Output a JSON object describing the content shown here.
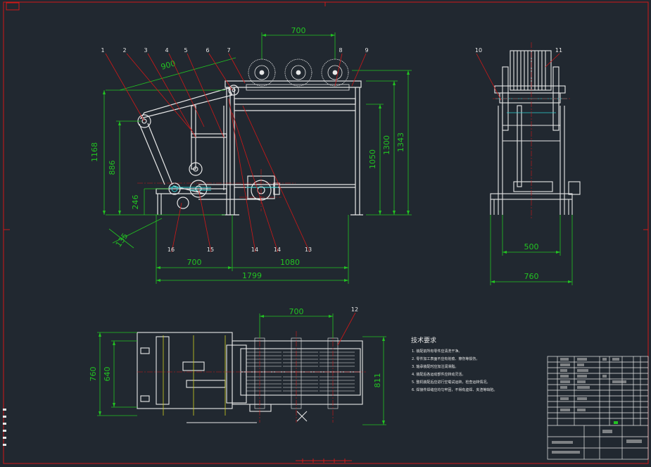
{
  "colors": {
    "background": "#212830",
    "frame": "#d01818",
    "outline": "#e8e8e8",
    "dimension": "#22c322",
    "leader": "#d01818",
    "centerline": "#d01818",
    "detail_cyan": "#30d0d0",
    "detail_yellow": "#d0d020"
  },
  "front_view": {
    "dims": {
      "brush_pitch": "700",
      "arm_length": "900",
      "height_1168": "1168",
      "height_886": "886",
      "height_246": "246",
      "angle_135": "135",
      "height_1050": "1050",
      "height_1300": "1300",
      "height_1343": "1343",
      "bottom_700": "700",
      "bottom_1080": "1080",
      "overall_1799": "1799"
    },
    "balloons_top": [
      "1",
      "2",
      "3",
      "4",
      "5",
      "6",
      "7",
      "8",
      "9"
    ],
    "balloons_bottom": [
      "16",
      "15",
      "14",
      "14",
      "13"
    ]
  },
  "side_view": {
    "balloons": [
      "10",
      "11"
    ],
    "dims": {
      "inner_width": "500",
      "overall_width": "760"
    }
  },
  "top_view": {
    "dims": {
      "brush_pitch": "700",
      "width_760": "760",
      "width_640": "640",
      "length_811": "811"
    },
    "balloon": "12"
  },
  "tech_notes": {
    "title": "技术要求",
    "items": [
      "1. 装配前所有零件应清洗干净。",
      "2. 零件加工表面不应有划痕、擦伤等损伤。",
      "3. 轴承装配时应加注润滑脂。",
      "4. 装配后各运动部件应转动灵活。",
      "5. 整机装配后应进行空载试运转，检查运转情况。",
      "6. 焊接件焊缝应均匀牢固，不得有虚焊、夹渣等缺陷。"
    ]
  }
}
